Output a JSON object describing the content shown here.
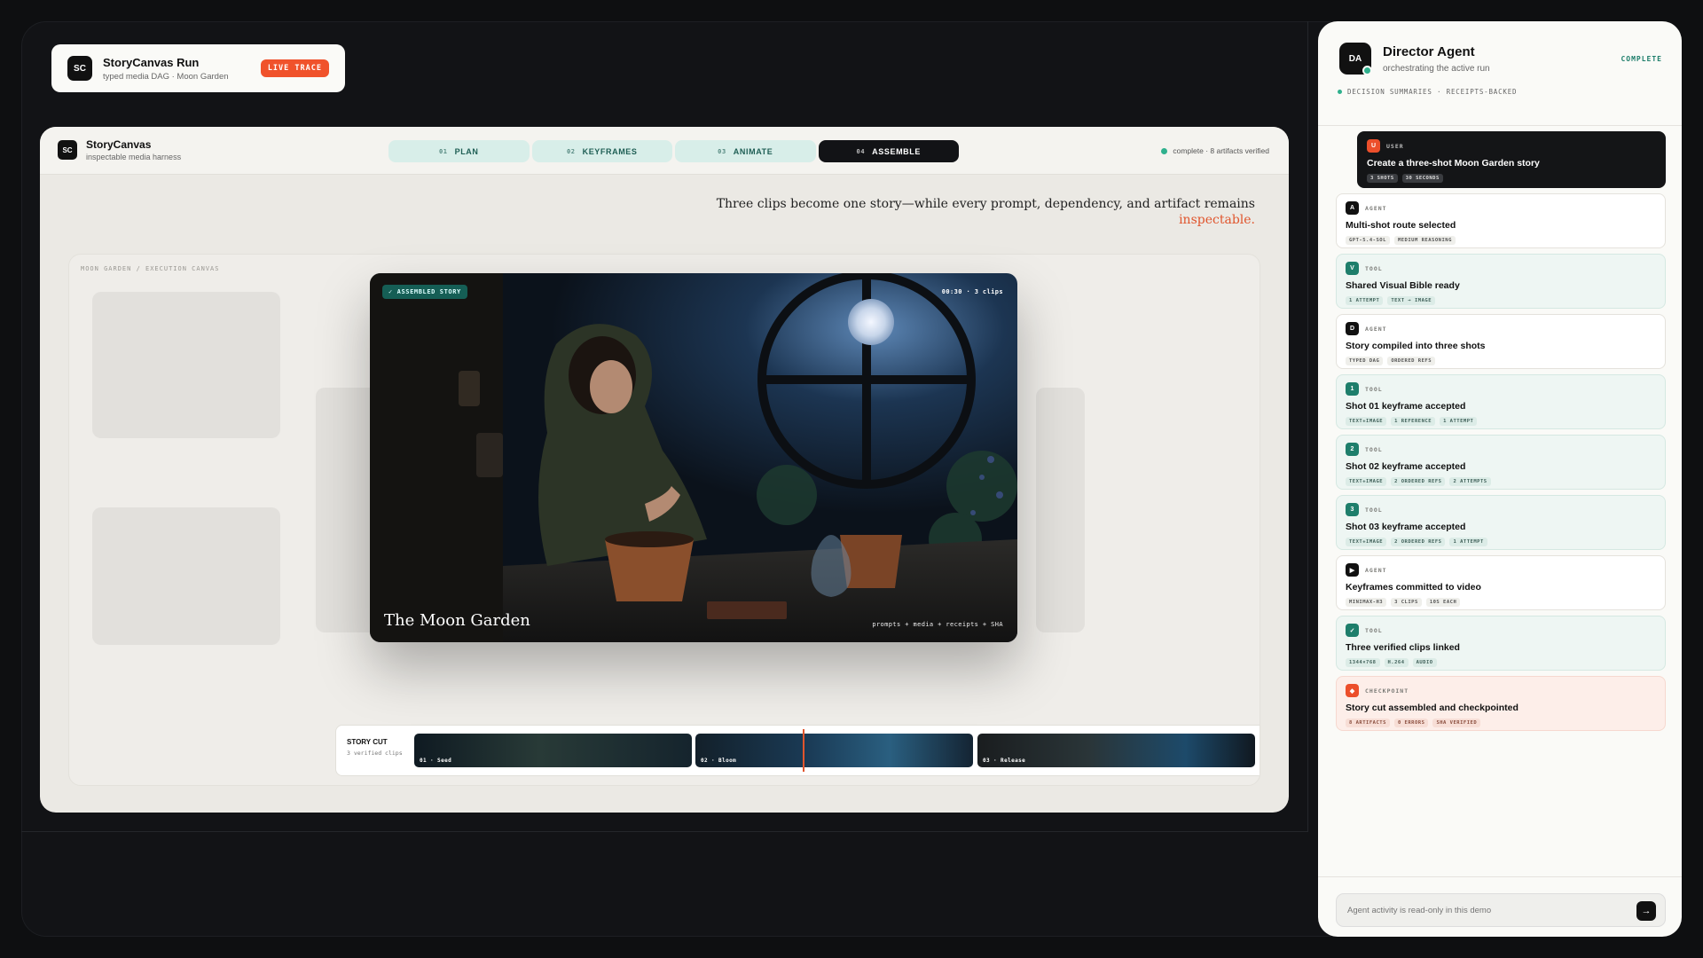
{
  "run": {
    "badge": "SC",
    "title": "StoryCanvas Run",
    "subtitle": "typed media DAG · Moon Garden",
    "live": "LIVE TRACE"
  },
  "app": {
    "badge": "SC",
    "title": "StoryCanvas",
    "subtitle": "inspectable media harness",
    "tabs": [
      {
        "num": "01",
        "label": "PLAN"
      },
      {
        "num": "02",
        "label": "KEYFRAMES"
      },
      {
        "num": "03",
        "label": "ANIMATE"
      },
      {
        "num": "04",
        "label": "ASSEMBLE"
      }
    ],
    "status": "complete · 8 artifacts verified",
    "tagline": "Three clips become one story—while every prompt, dependency, and artifact remains",
    "tagline_accent": "inspectable.",
    "breadcrumb": "MOON GARDEN / EXECUTION CANVAS"
  },
  "hero": {
    "pill": "✓ ASSEMBLED STORY",
    "time": "00:30 · 3 clips",
    "title": "The Moon Garden",
    "footer": "prompts + media + receipts + SHA"
  },
  "cut": {
    "label": "STORY CUT",
    "sub": "3 verified clips",
    "clips": [
      "01 · Seed",
      "02 · Bloom",
      "03 · Release"
    ]
  },
  "panel": {
    "badge": "DA",
    "title": "Director Agent",
    "subtitle": "orchestrating the active run",
    "complete": "COMPLETE",
    "tags": "DECISION SUMMARIES · RECEIPTS-BACKED",
    "events": [
      {
        "kind": "USER",
        "icon": "U",
        "title": "Create a three-shot Moon Garden story",
        "chips": [
          "3 SHOTS",
          "30 SECONDS"
        ]
      },
      {
        "kind": "AGENT",
        "icon": "A",
        "title": "Multi-shot route selected",
        "chips": [
          "GPT-5.4-SOL",
          "MEDIUM REASONING"
        ]
      },
      {
        "kind": "TOOL",
        "icon": "V",
        "title": "Shared Visual Bible ready",
        "chips": [
          "1 ATTEMPT",
          "TEXT → IMAGE"
        ]
      },
      {
        "kind": "AGENT",
        "icon": "D",
        "title": "Story compiled into three shots",
        "chips": [
          "TYPED DAG",
          "ORDERED REFS"
        ]
      },
      {
        "kind": "TOOL",
        "icon": "1",
        "title": "Shot 01 keyframe accepted",
        "chips": [
          "TEXT+IMAGE",
          "1 REFERENCE",
          "1 ATTEMPT"
        ]
      },
      {
        "kind": "TOOL",
        "icon": "2",
        "title": "Shot 02 keyframe accepted",
        "chips": [
          "TEXT+IMAGE",
          "2 ORDERED REFS",
          "2 ATTEMPTS"
        ]
      },
      {
        "kind": "TOOL",
        "icon": "3",
        "title": "Shot 03 keyframe accepted",
        "chips": [
          "TEXT+IMAGE",
          "2 ORDERED REFS",
          "1 ATTEMPT"
        ]
      },
      {
        "kind": "AGENT",
        "icon": "▶",
        "title": "Keyframes committed to video",
        "chips": [
          "MINIMAX-H3",
          "3 CLIPS",
          "10S EACH"
        ]
      },
      {
        "kind": "TOOL",
        "icon": "✓",
        "title": "Three verified clips linked",
        "chips": [
          "1344×768",
          "H.264",
          "AUDIO"
        ]
      },
      {
        "kind": "CHECKPOINT",
        "icon": "◆",
        "title": "Story cut assembled and checkpointed",
        "chips": [
          "8 ARTIFACTS",
          "0 ERRORS",
          "SHA VERIFIED"
        ]
      }
    ],
    "input_placeholder": "Agent activity is read-only in this demo",
    "send_icon": "arrow-right-icon"
  },
  "colors": {
    "accent": "#e0552d",
    "teal": "#1e7e6b",
    "dark": "#121316"
  }
}
